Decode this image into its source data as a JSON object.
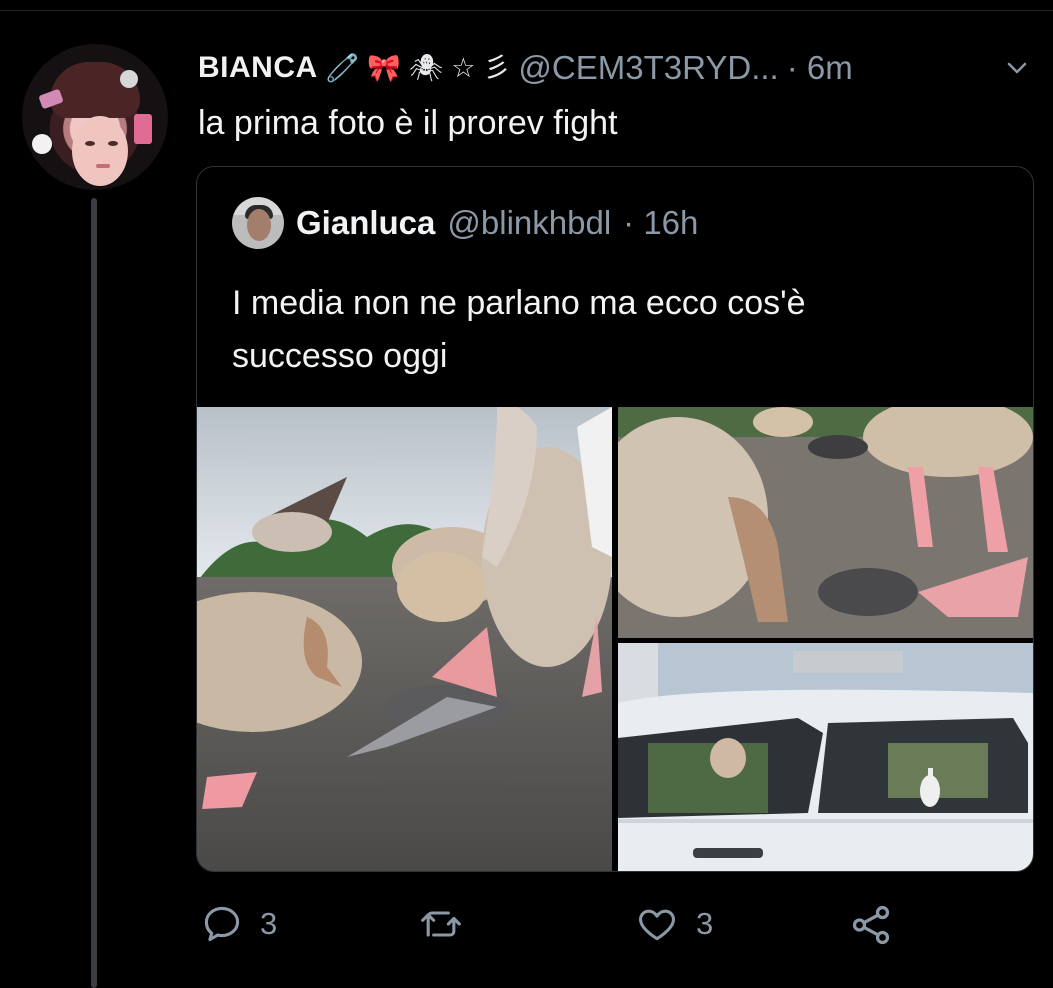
{
  "tweet": {
    "display_name": "BIANCA",
    "name_emojis": [
      "🧷",
      "🎀",
      "🕷",
      "☆",
      "彡"
    ],
    "handle": "@CEM3T3RYD...",
    "time": "· 6m",
    "text": "la prima foto è il prorev fight"
  },
  "quoted_tweet": {
    "display_name": "Gianluca",
    "handle": "@blinkhbdl",
    "time": "· 16h",
    "text_line1": "I media non ne parlano ma ecco cos'è",
    "text_line2": "successo oggi"
  },
  "actions": {
    "reply_count": "3",
    "like_count": "3"
  },
  "colors": {
    "background": "#000000",
    "text": "#e7e9ea",
    "muted": "#8b98a5",
    "border": "#2f3336"
  },
  "icons": {
    "more": "chevron-down-icon",
    "reply": "reply-icon",
    "retweet": "retweet-icon",
    "like": "heart-icon",
    "share": "share-icon"
  }
}
